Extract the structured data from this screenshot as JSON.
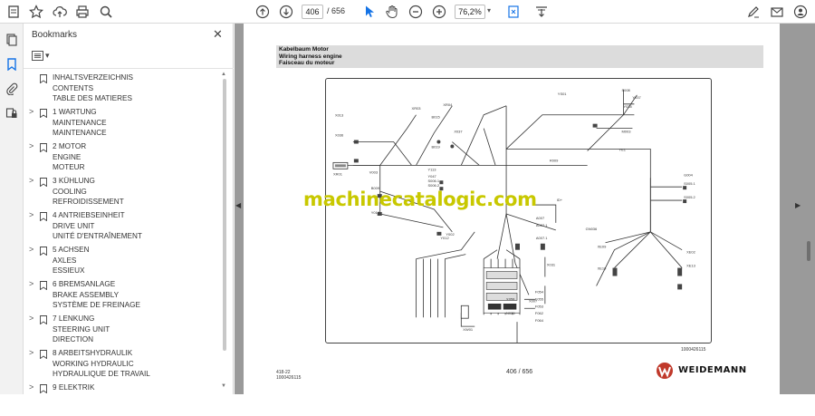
{
  "toolbar": {
    "current_page": "406",
    "page_sep": "/  656",
    "zoom": "76,2%"
  },
  "panel": {
    "title": "Bookmarks",
    "items": [
      {
        "lines": [
          "INHALTSVERZEICHNIS",
          "CONTENTS",
          "TABLE DES MATIERES"
        ],
        "expandable": false
      },
      {
        "lines": [
          "1 WARTUNG",
          "MAINTENANCE",
          "MAINTENANCE"
        ],
        "expandable": true
      },
      {
        "lines": [
          "2 MOTOR",
          "ENGINE",
          "MOTEUR"
        ],
        "expandable": true
      },
      {
        "lines": [
          "3 KÜHLUNG",
          "COOLING",
          "REFROIDISSEMENT"
        ],
        "expandable": true
      },
      {
        "lines": [
          "4 ANTRIEBSEINHEIT",
          "DRIVE UNIT",
          "UNITÉ D'ENTRAÎNEMENT"
        ],
        "expandable": true
      },
      {
        "lines": [
          "5 ACHSEN",
          "AXLES",
          "ESSIEUX"
        ],
        "expandable": true
      },
      {
        "lines": [
          "6 BREMSANLAGE",
          "BRAKE ASSEMBLY",
          "SYSTÈME DE FREINAGE"
        ],
        "expandable": true
      },
      {
        "lines": [
          "7 LENKUNG",
          "STEERING UNIT",
          "DIRECTION"
        ],
        "expandable": true
      },
      {
        "lines": [
          "8 ARBEITSHYDRAULIK",
          "WORKING HYDRAULIC",
          "HYDRAULIQUE DE TRAVAIL"
        ],
        "expandable": true
      },
      {
        "lines": [
          "9 ELEKTRIK",
          "",
          ""
        ],
        "expandable": true
      }
    ]
  },
  "document": {
    "title_lines": [
      "Kabelbaum Motor",
      "Wiring harness engine",
      "Faisceau du moteur"
    ],
    "drawing_code": "1000426115",
    "footer_left": [
      "418-22",
      "1000426115"
    ],
    "footer_page": "406 / 656",
    "brand": "WEIDEMANN",
    "watermark": "machinecatalogic.com",
    "labels": [
      "XR03",
      "XR04",
      "X013",
      "X036",
      "B015",
      "B019",
      "X037",
      "XR01",
      "V003",
      "Y113",
      "Y047",
      "S006.1",
      "S006.2",
      "B009",
      "Y010",
      "Y012",
      "Y002",
      "YS01",
      "S008",
      "Y037",
      "Y035",
      "M003",
      "YE1",
      "R009",
      "G004",
      "S005.1",
      "S005.2",
      "ID+",
      "A007",
      "A007.1",
      "A007.1",
      "GN036",
      "XE09",
      "XE10",
      "XE02",
      "XE13",
      "X031",
      "X007",
      "F054",
      "F055",
      "F053",
      "F062",
      "F064",
      "N025",
      "X058",
      "XW01"
    ]
  },
  "colors": {
    "accent": "#1473e6",
    "watermark": "#c8c800",
    "brand_red": "#c0392b"
  }
}
